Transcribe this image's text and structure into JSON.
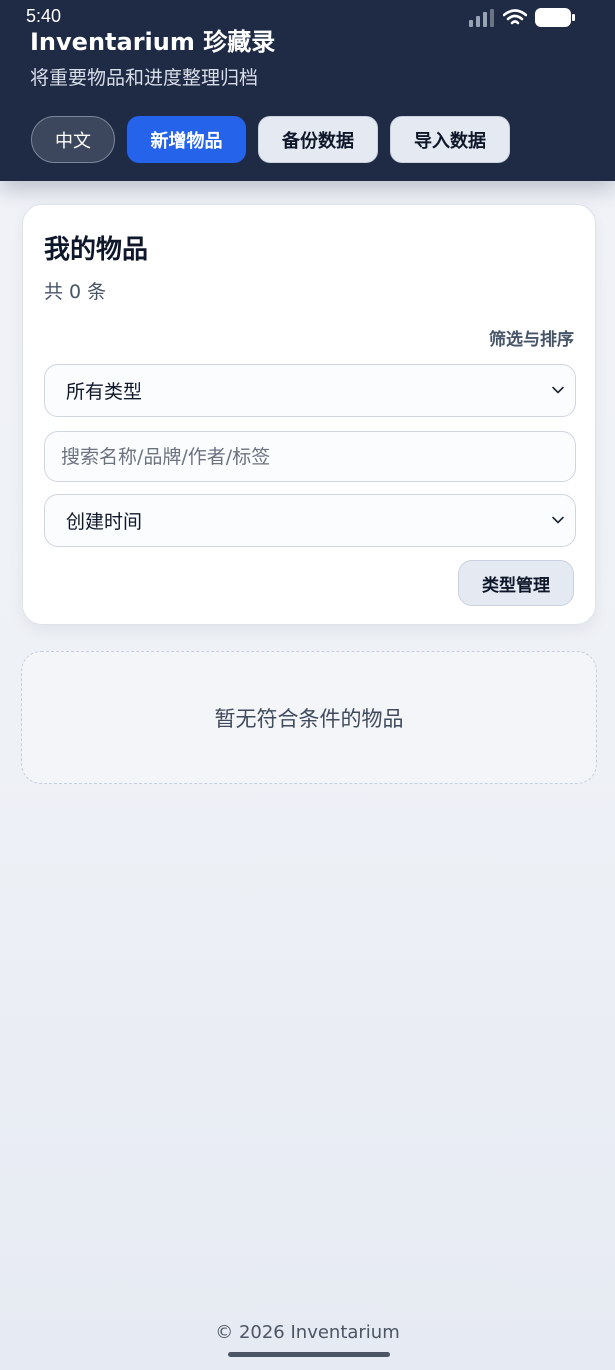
{
  "status_bar": {
    "time": "5:40"
  },
  "header": {
    "title": "Inventarium 珍藏录",
    "subtitle": "将重要物品和进度整理归档",
    "buttons": {
      "language": "中文",
      "add_item": "新增物品",
      "backup": "备份数据",
      "import": "导入数据"
    }
  },
  "card": {
    "title": "我的物品",
    "count": "共 0 条",
    "filter_label": "筛选与排序",
    "type_select": {
      "selected": "所有类型"
    },
    "search": {
      "placeholder": "搜索名称/品牌/作者/标签",
      "value": ""
    },
    "sort_select": {
      "selected": "创建时间"
    },
    "type_manage_button": "类型管理"
  },
  "empty_state": {
    "message": "暂无符合条件的物品"
  },
  "footer": {
    "text": "© 2026 Inventarium"
  },
  "colors": {
    "header_bg": "#1f2a44",
    "primary": "#2563eb",
    "light_button": "#e5eaf2"
  },
  "icons": {
    "signal": "cellular-signal-icon",
    "wifi": "wifi-icon",
    "battery": "battery-icon",
    "chevron": "chevron-down-icon"
  }
}
